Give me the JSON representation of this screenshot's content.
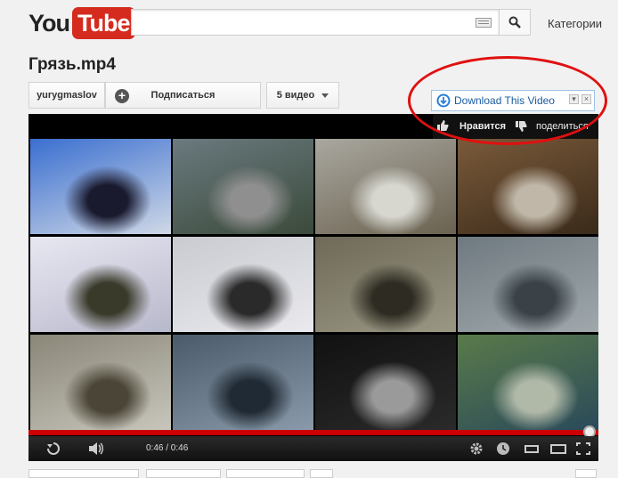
{
  "header": {
    "logo_you": "You",
    "logo_tube": "Tube",
    "search": {
      "placeholder": ""
    },
    "categories_label": "Категории"
  },
  "video": {
    "title": "Грязь.mp4",
    "channel": "yurygmaslov",
    "subscribe_label": "Подписаться",
    "videos_count_label": "5 видео"
  },
  "overlay": {
    "download_label": "Download This Video",
    "like_label": "Нравится",
    "share_label": "поделиться"
  },
  "player": {
    "current_time": "0:46",
    "separator": " / ",
    "duration": "0:46",
    "time_text": "0:46 / 0:46",
    "progress_fraction": 1.0
  },
  "thumbnails": [
    {
      "name": "thumb-news-anchor",
      "colors": [
        "#3a6fd0",
        "#cfd8e6",
        "#1a1a2e"
      ]
    },
    {
      "name": "thumb-race-track",
      "colors": [
        "#6a7a7f",
        "#3b4a3a",
        "#8f8f8f"
      ]
    },
    {
      "name": "thumb-car-in-woods",
      "colors": [
        "#a9a79f",
        "#6b6250",
        "#d7d7d0"
      ]
    },
    {
      "name": "thumb-motorcycle-trial",
      "colors": [
        "#7a5a3a",
        "#3a2a1a",
        "#c0b7a8"
      ]
    },
    {
      "name": "thumb-truck-in-snow",
      "colors": [
        "#e8e8f2",
        "#b8b8cc",
        "#3a3a2a"
      ]
    },
    {
      "name": "thumb-suv-in-snow",
      "colors": [
        "#c9cbd0",
        "#e9e9ee",
        "#2a2a2a"
      ]
    },
    {
      "name": "thumb-cars-mud-road",
      "colors": [
        "#6f6a58",
        "#9a9784",
        "#2e2c22"
      ]
    },
    {
      "name": "thumb-suv-in-water",
      "colors": [
        "#6f7a80",
        "#a0a8ac",
        "#3a4247"
      ]
    },
    {
      "name": "thumb-forest-cabin",
      "colors": [
        "#8a8678",
        "#c8c6bc",
        "#4a4536"
      ]
    },
    {
      "name": "thumb-people-picnic",
      "colors": [
        "#4a5a6a",
        "#8a9aaa",
        "#202a34"
      ]
    },
    {
      "name": "thumb-wheel-closeup",
      "colors": [
        "#111111",
        "#2a2a2a",
        "#9a9a9a"
      ]
    },
    {
      "name": "thumb-green-suv",
      "colors": [
        "#5a7a4a",
        "#2a4a5a",
        "#b0b8a8"
      ]
    }
  ],
  "colors": {
    "brand_red": "#d52b1e",
    "annotation_red": "#e01010",
    "link_blue": "#1a5b9e",
    "progress_red": "#cc0000"
  }
}
